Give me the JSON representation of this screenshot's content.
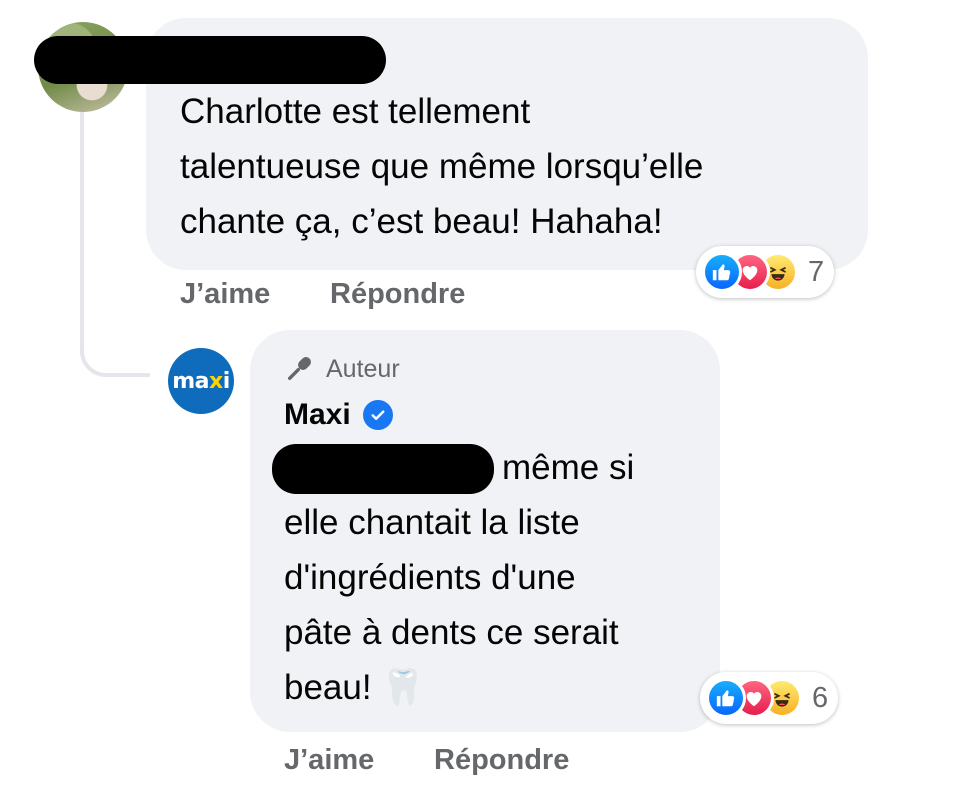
{
  "comment1": {
    "author_name_redacted": true,
    "lines": [
      "Charlotte est tellement",
      "talentueuse que même lorsqu’elle",
      "chante ça, c’est beau! Hahaha!"
    ],
    "reactions": {
      "icons": [
        "like-icon",
        "love-icon",
        "haha-icon"
      ],
      "count": "7"
    },
    "actions": {
      "like": "J’aime",
      "reply": "Répondre"
    }
  },
  "reply1": {
    "author_badge": "Auteur",
    "author_name": "Maxi",
    "avatar_text": {
      "ma": "ma",
      "x": "x",
      "i": "i"
    },
    "verified": true,
    "first_line_tail": "même si",
    "lines": [
      "elle chantait la liste",
      "d'ingrédients d'une",
      "pâte à dents ce serait",
      "beau!"
    ],
    "tooth_emoji": "🦷",
    "reactions": {
      "icons": [
        "like-icon",
        "love-icon",
        "haha-icon"
      ],
      "count": "6"
    },
    "actions": {
      "like": "J’aime",
      "reply": "Répondre"
    }
  },
  "colors": {
    "bubble": "#f0f2f5",
    "secondary_text": "#65676b",
    "verified_blue": "#1877f2",
    "maxi_blue": "#0f6cbd"
  }
}
